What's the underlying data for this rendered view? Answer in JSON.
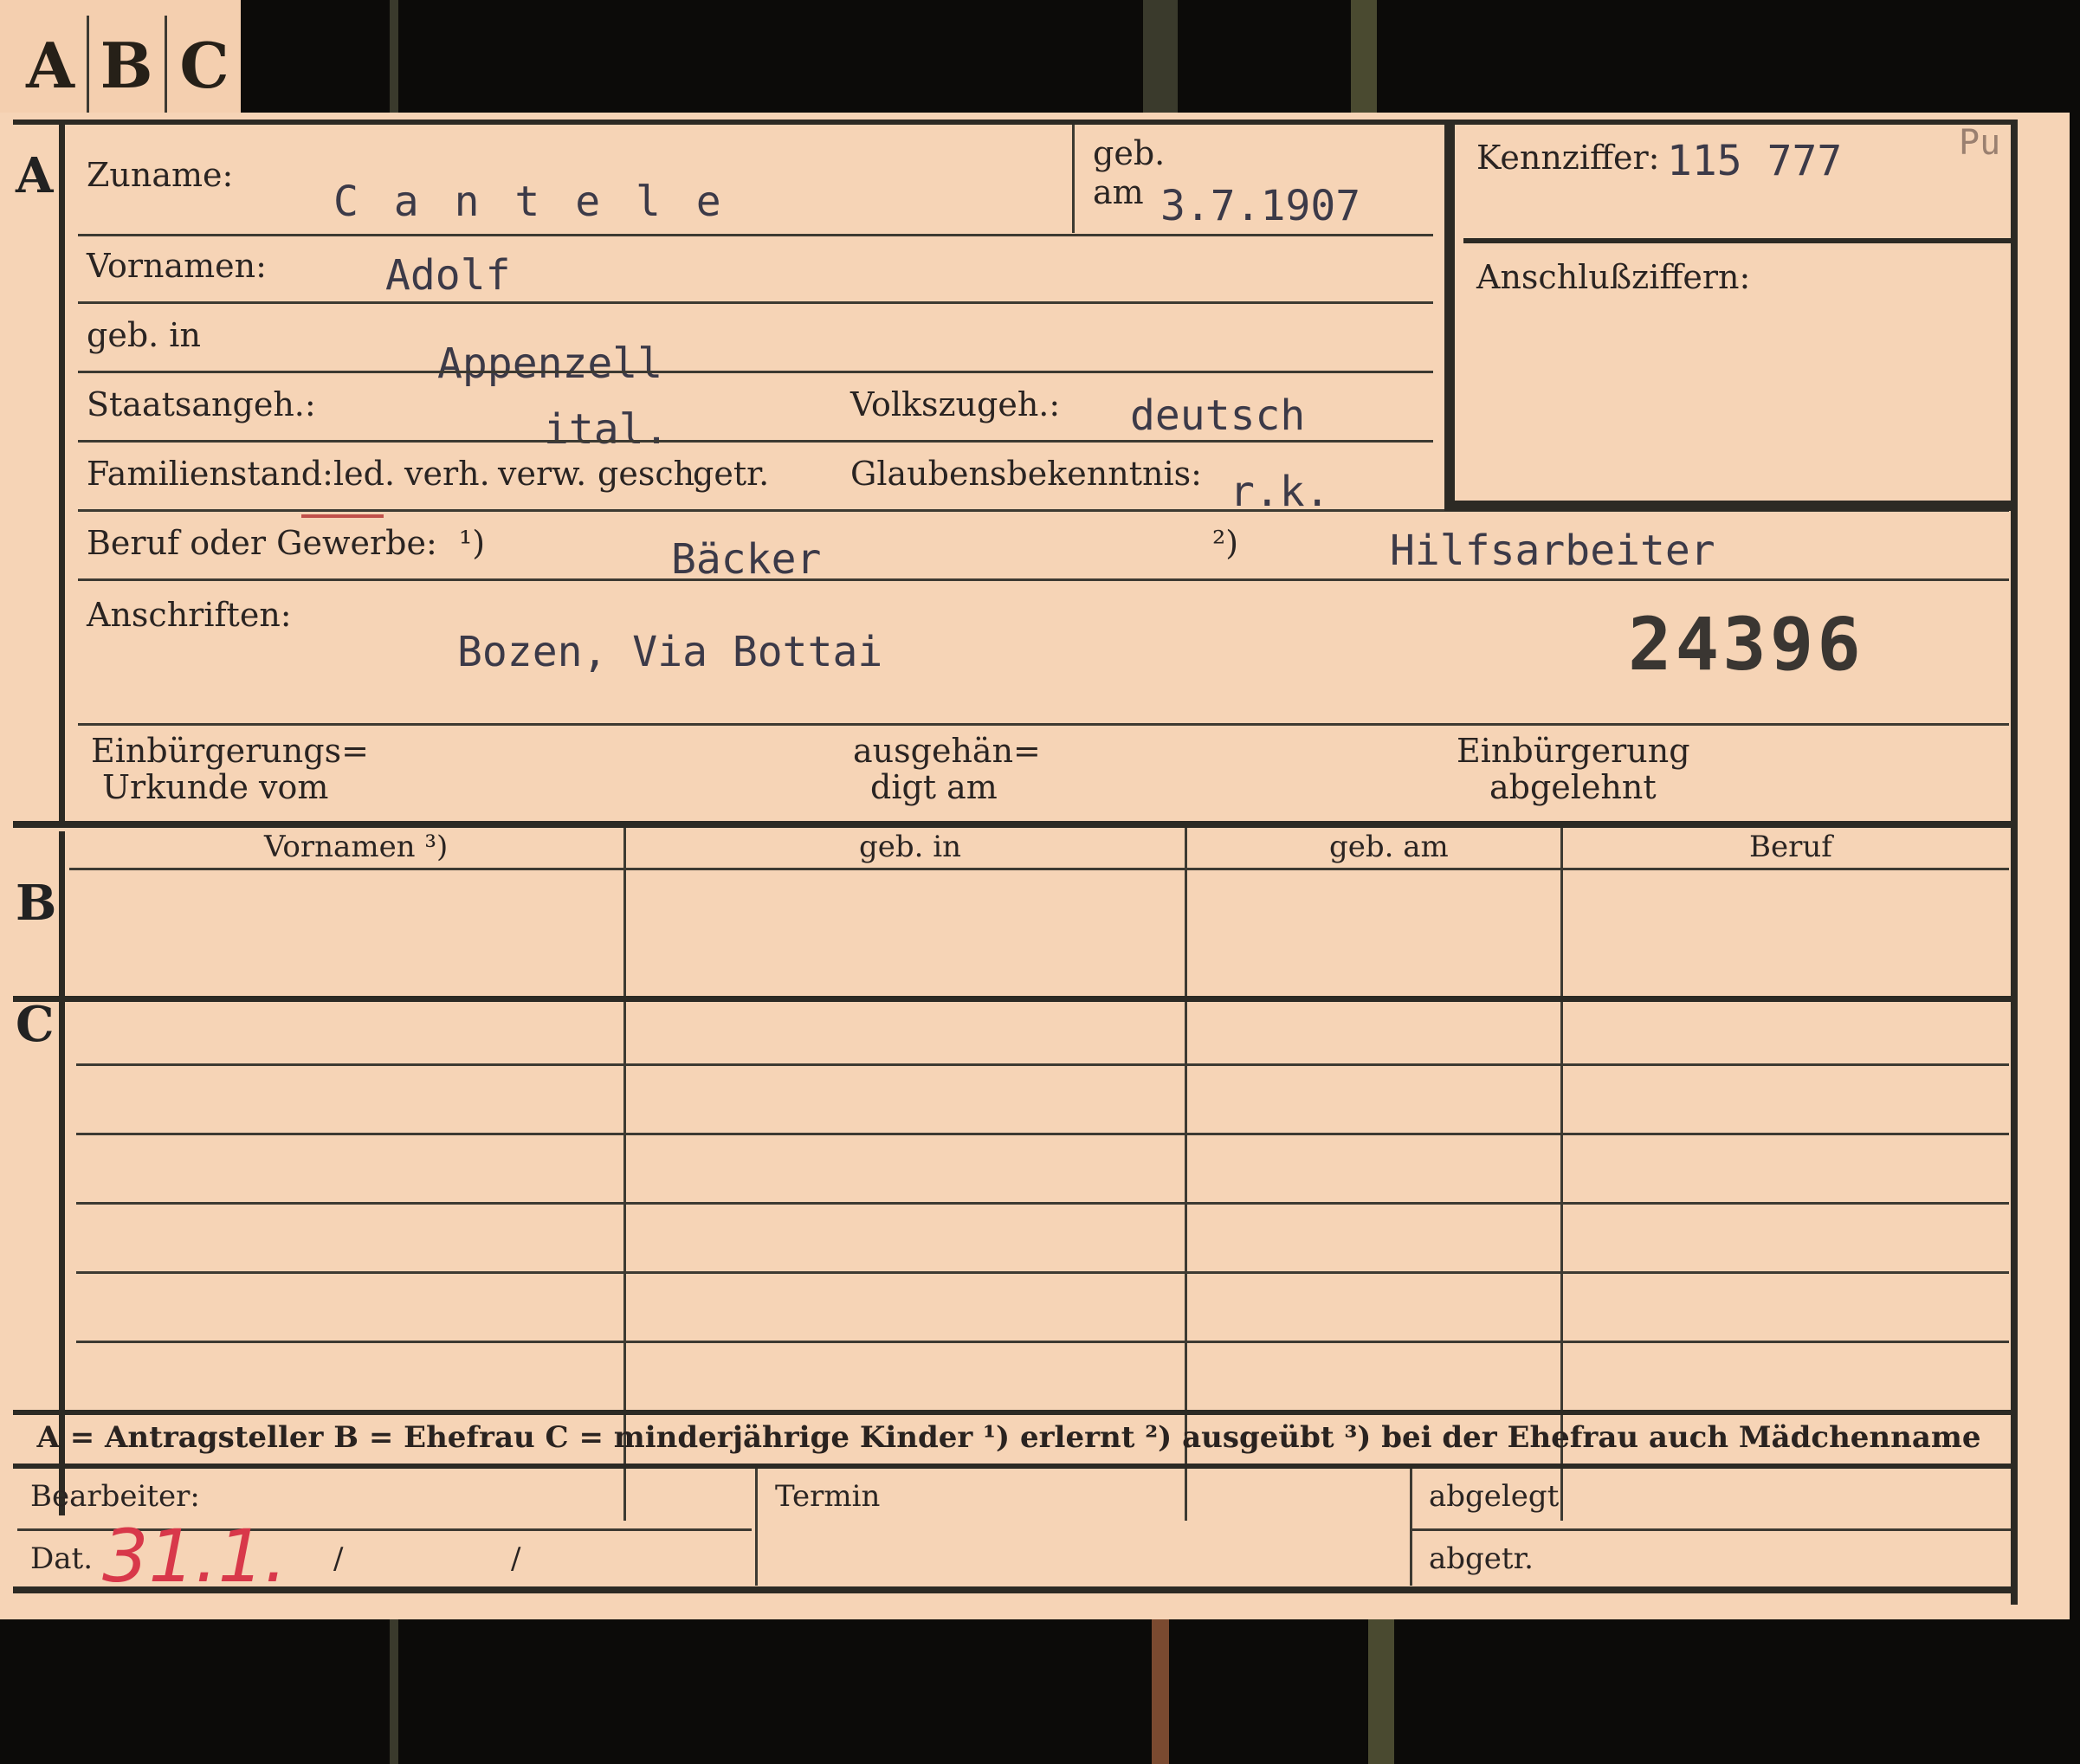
{
  "tabs": [
    "A",
    "B",
    "C"
  ],
  "sections": [
    "A",
    "B",
    "C"
  ],
  "section_a": {
    "zuname_label": "Zuname:",
    "zuname_value": "C a n t e l e",
    "geb_label": "geb.",
    "am_label": "am",
    "geb_am_value": "3.7.1907",
    "vornamen_label": "Vornamen:",
    "vornamen_value": "Adolf",
    "geb_in_label": "geb. in",
    "geb_in_value": "Appenzell",
    "staatsangeh_label": "Staatsangeh.:",
    "staatsangeh_value": "ital.",
    "volkszugeh_label": "Volkszugeh.:",
    "volkszugeh_value": "deutsch",
    "familienstand_label": "Familienstand:",
    "familienstand_options": [
      "led.",
      "verh.",
      "verw.",
      "gesch.",
      "getr."
    ],
    "glaubens_label": "Glaubensbekenntnis:",
    "glaubens_value": "r.k.",
    "beruf_label": "Beruf oder Gewerbe:",
    "beruf_mark1": "¹)",
    "beruf_value1": "Bäcker",
    "beruf_mark2": "²)",
    "beruf_value2": "Hilfsarbeiter",
    "anschriften_label": "Anschriften:",
    "anschriften_value": "Bozen, Via Bottai",
    "stamp_number": "24396",
    "einb_urkunde_label_1": "Einbürgerungs=",
    "einb_urkunde_label_2": "Urkunde vom",
    "ausgeh_label_1": "ausgehän=",
    "ausgeh_label_2": "digt am",
    "einb_abgelehnt_label_1": "Einbürgerung",
    "einb_abgelehnt_label_2": "abgelehnt"
  },
  "kennziffer": {
    "label": "Kennziffer:",
    "value": "115 777",
    "corner_mark": "Pu",
    "anschluss_label": "Anschlußziffern:"
  },
  "table": {
    "headers": [
      "Vornamen ³)",
      "geb. in",
      "geb. am",
      "Beruf"
    ]
  },
  "legend": "A = Antragsteller   B = Ehefrau   C = minderjährige Kinder   ¹) erlernt   ²) ausgeübt   ³) bei der Ehefrau auch Mädchenname",
  "footer": {
    "bearbeiter_label": "Bearbeiter:",
    "dat_label": "Dat.",
    "dat_value": "31.1.",
    "slash1": "/",
    "slash2": "/",
    "termin_label": "Termin",
    "abgelegt_label": "abgelegt",
    "abgetr_label": "abgetr."
  },
  "colors": {
    "card": "#f6d4b6",
    "background": "#0c0b09",
    "ink": "#2a2320",
    "typewriter": "#3c3a48",
    "red_pencil": "#d8384a"
  }
}
